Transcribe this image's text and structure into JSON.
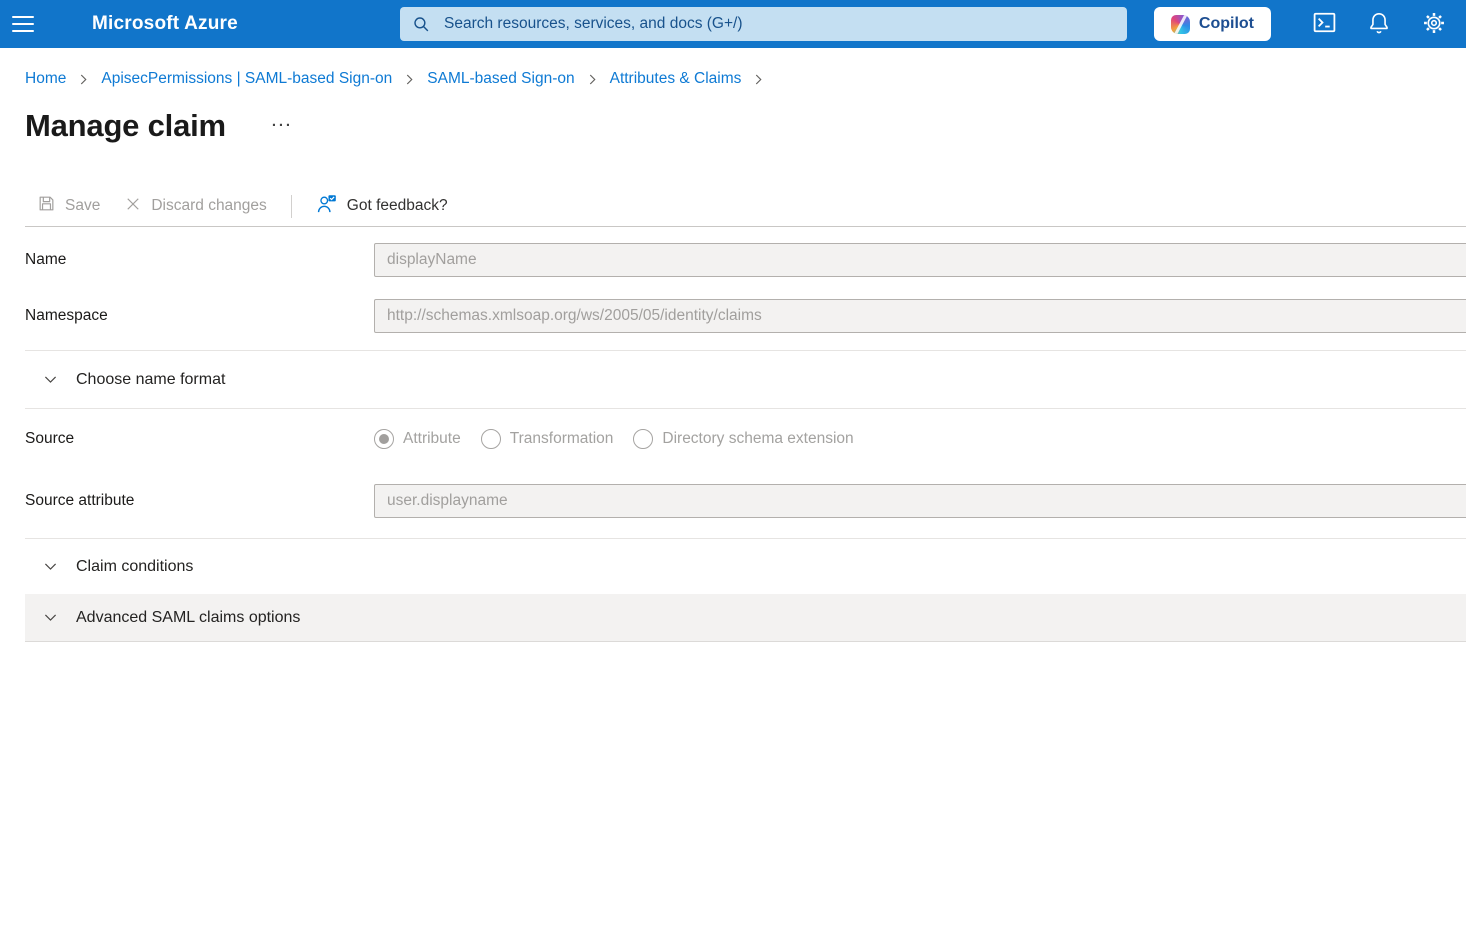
{
  "topbar": {
    "brand": "Microsoft Azure",
    "search": {
      "placeholder": "Search resources, services, and docs (G+/)"
    },
    "copilot_label": "Copilot",
    "colors": {
      "bar_background": "#1175ca",
      "search_background": "#c4dff2",
      "search_text": "#18528c",
      "copilot_text": "#1d4e91"
    }
  },
  "breadcrumb": {
    "items": [
      {
        "label": "Home"
      },
      {
        "label": "ApisecPermissions | SAML-based Sign-on"
      },
      {
        "label": "SAML-based Sign-on"
      },
      {
        "label": "Attributes & Claims"
      }
    ],
    "link_color": "#0e7ad4"
  },
  "page": {
    "title": "Manage claim",
    "ellipsis": "···"
  },
  "toolbar": {
    "save_label": "Save",
    "discard_label": "Discard changes",
    "feedback_label": "Got feedback?",
    "disabled_color": "#a19f9d",
    "feedback_icon_color": "#0078d4"
  },
  "form": {
    "name": {
      "label": "Name",
      "value": "displayName"
    },
    "namespace": {
      "label": "Namespace",
      "value": "http://schemas.xmlsoap.org/ws/2005/05/identity/claims"
    },
    "source": {
      "label": "Source",
      "options": [
        {
          "label": "Attribute",
          "selected": true
        },
        {
          "label": "Transformation",
          "selected": false
        },
        {
          "label": "Directory schema extension",
          "selected": false
        }
      ]
    },
    "source_attribute": {
      "label": "Source attribute",
      "value": "user.displayname"
    },
    "sections": {
      "choose_name_format": "Choose name format",
      "claim_conditions": "Claim conditions",
      "advanced_options": "Advanced SAML claims options"
    }
  },
  "icons": {
    "hamburger-icon": "three horizontal bars",
    "search-icon": "magnifier",
    "copilot-icon": "multicolor copilot ribbon",
    "cloud-shell-icon": "terminal prompt >_",
    "notifications-bell-icon": "bell outline",
    "settings-gear-icon": "gear outline",
    "save-icon": "floppy disk outline",
    "discard-icon": "x cross",
    "feedback-icon": "person with check bubble",
    "chevron-down-icon": "v chevron",
    "breadcrumb-chevron-icon": "> chevron",
    "ellipsis-icon": "horizontal dots"
  }
}
